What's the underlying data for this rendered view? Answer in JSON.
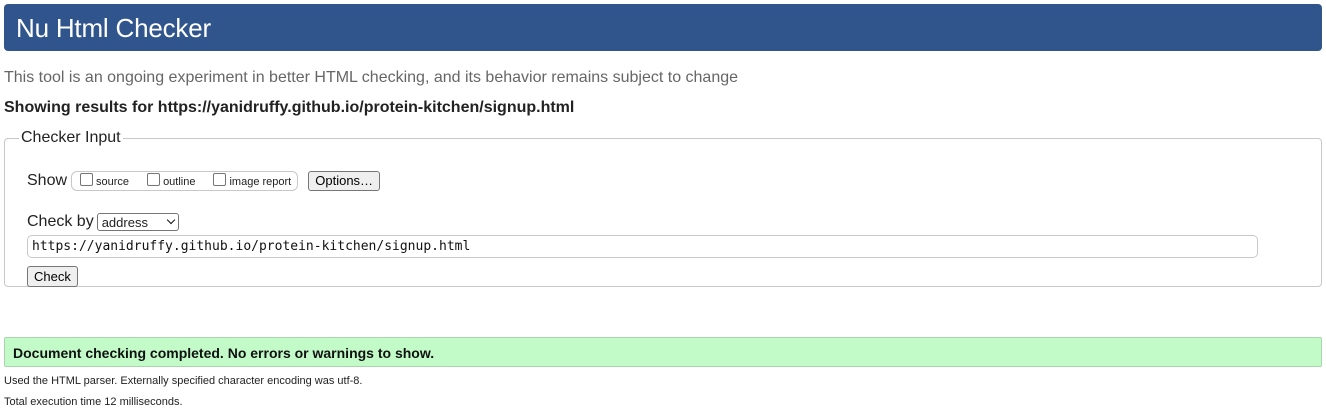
{
  "header": {
    "title": "Nu Html Checker"
  },
  "intro": "This tool is an ongoing experiment in better HTML checking, and its behavior remains subject to change",
  "results_for": "Showing results for https://yanidruffy.github.io/protein-kitchen/signup.html",
  "checker_input": {
    "legend": "Checker Input",
    "show_label": "Show",
    "show_options": [
      {
        "label": "source",
        "checked": false
      },
      {
        "label": "outline",
        "checked": false
      },
      {
        "label": "image report",
        "checked": false
      }
    ],
    "options_button": "Options…",
    "check_by_label": "Check by",
    "check_by_value": "address",
    "url_value": "https://yanidruffy.github.io/protein-kitchen/signup.html",
    "check_button": "Check"
  },
  "result": {
    "message": "Document checking completed. No errors or warnings to show.",
    "color": "#c2fbc8"
  },
  "stats": {
    "parser": "Used the HTML parser. Externally specified character encoding was utf-8.",
    "time": "Total execution time 12 milliseconds."
  },
  "colors": {
    "header_bg": "#30558c"
  }
}
